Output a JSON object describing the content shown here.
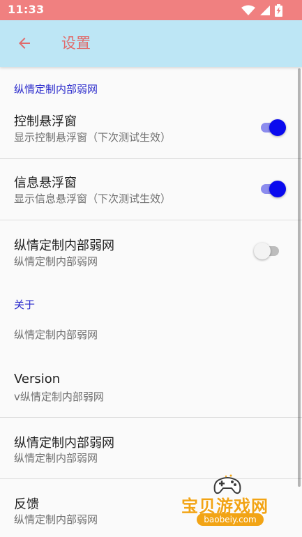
{
  "status_bar": {
    "time": "11:33",
    "icons": [
      "wifi-icon",
      "cell-signal-icon",
      "battery-charging-icon"
    ],
    "background_color": "#f08080"
  },
  "app_bar": {
    "back_icon": "arrow-left-icon",
    "title": "设置",
    "background_color": "#bde6f5",
    "title_color": "#e06b6b"
  },
  "sections": {
    "general": {
      "header": "纵情定制内部弱网",
      "items": [
        {
          "title": "控制悬浮窗",
          "summary": "显示控制悬浮窗（下次测试生效）",
          "switch_on": true
        },
        {
          "title": "信息悬浮窗",
          "summary": "显示信息悬浮窗（下次测试生效）",
          "switch_on": true
        },
        {
          "title": "纵情定制内部弱网",
          "summary": "纵情定制内部弱网",
          "switch_on": false
        }
      ]
    },
    "about": {
      "header": "关于",
      "items": [
        {
          "summary": "纵情定制内部弱网"
        },
        {
          "title": "Version",
          "summary": "v纵情定制内部弱网"
        },
        {
          "title": "纵情定制内部弱网",
          "summary": "纵情定制内部弱网"
        },
        {
          "title": "反馈",
          "summary": "纵情定制内部弱网"
        }
      ]
    }
  },
  "colors": {
    "accent": "#0a0aee",
    "category_text": "#2b2bcc"
  },
  "watermark": {
    "text": "宝贝游戏网",
    "url": "baobeiy.com"
  }
}
